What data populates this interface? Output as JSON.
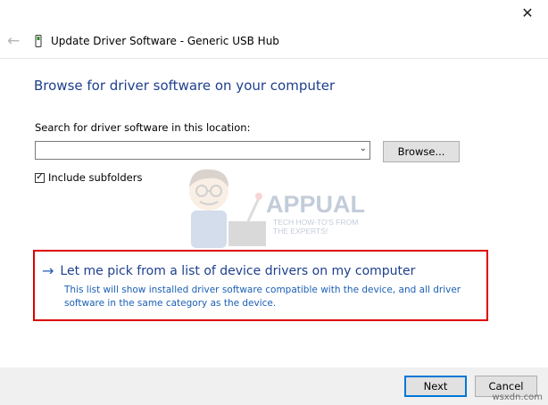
{
  "window": {
    "close_symbol": "✕",
    "title": "Update Driver Software - Generic USB Hub",
    "back_symbol": "←"
  },
  "page": {
    "heading": "Browse for driver software on your computer",
    "search_label": "Search for driver software in this location:",
    "path_value": "",
    "browse_label": "Browse...",
    "include_subfolders_label": "Include subfolders",
    "include_subfolders_checked": true,
    "check_mark": "✓"
  },
  "watermark": {
    "brand": "APPUALS",
    "tagline_1": "TECH HOW-TO'S FROM",
    "tagline_2": "THE EXPERTS!"
  },
  "pick_option": {
    "arrow": "→",
    "title": "Let me pick from a list of device drivers on my computer",
    "description": "This list will show installed driver software compatible with the device, and all driver software in the same category as the device."
  },
  "footer": {
    "next_label": "Next",
    "cancel_label": "Cancel",
    "site": "wsxdn.com"
  },
  "colors": {
    "heading": "#1e3f8e",
    "link": "#1a5fb4",
    "highlight_border": "#dd0000",
    "default_button_border": "#0078d7"
  },
  "icons": {
    "back": "back-arrow-icon",
    "usb": "usb-device-icon",
    "dropdown": "chevron-down-icon",
    "close": "close-icon"
  }
}
